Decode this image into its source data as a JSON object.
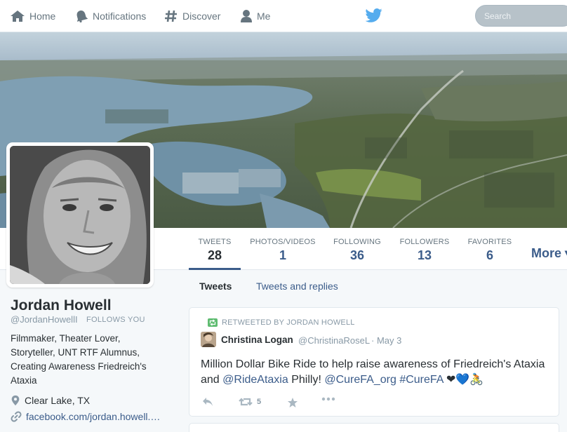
{
  "nav": {
    "home": "Home",
    "notifications": "Notifications",
    "discover": "Discover",
    "me": "Me",
    "search_placeholder": "Search"
  },
  "profile": {
    "name": "Jordan Howell",
    "handle": "@JordanHowellI",
    "follows_you": "FOLLOWS YOU",
    "bio": "Filmmaker, Theater Lover, Storyteller, UNT RTF Alumnus, Creating Awareness Friedreich's Ataxia",
    "location": "Clear Lake, TX",
    "website": "facebook.com/jordan.howell.…"
  },
  "stats": {
    "tweets_label": "TWEETS",
    "tweets": "28",
    "photos_label": "PHOTOS/VIDEOS",
    "photos": "1",
    "following_label": "FOLLOWING",
    "following": "36",
    "followers_label": "FOLLOWERS",
    "followers": "13",
    "favorites_label": "FAVORITES",
    "favorites": "6",
    "more": "More ▾"
  },
  "timeline": {
    "tab_tweets": "Tweets",
    "tab_replies": "Tweets and replies",
    "tweet": {
      "retweeted_by": "RETWEETED BY JORDAN HOWELL",
      "author": "Christina Logan",
      "author_handle": "@ChristinaRoseL",
      "date": "· May 3",
      "text_1": "Million Dollar Bike Ride to help raise awareness of Friedreich's Ataxia and ",
      "mention_1": "@RideAtaxia",
      "text_2": " Philly! ",
      "mention_2": "@CureFA_org",
      "hashtag": "#CureFA",
      "emoji": " ❤💙🚴",
      "retweet_count": "5"
    }
  },
  "colors": {
    "accent": "#3b5c8a",
    "twitter_blue": "#55acee",
    "retweet_green": "#5fbc71",
    "muted": "#8899a6"
  },
  "icons": [
    "home-icon",
    "bell-icon",
    "hash-icon",
    "person-icon",
    "twitter-bird-icon",
    "location-pin-icon",
    "link-icon",
    "retweet-icon",
    "reply-icon",
    "star-icon",
    "ellipsis-icon"
  ]
}
